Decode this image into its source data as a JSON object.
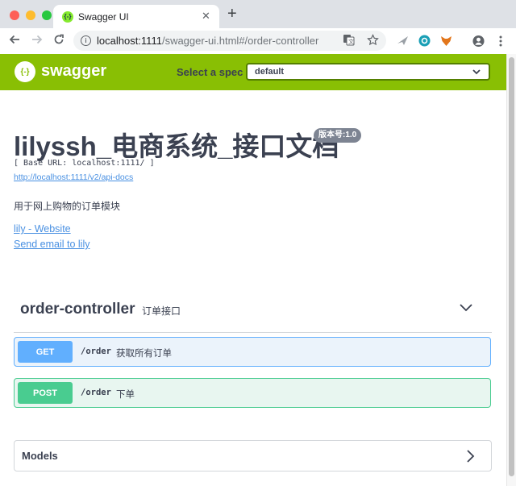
{
  "browser": {
    "tab_title": "Swagger UI",
    "tab_favicon": "{-}",
    "close_glyph": "✕",
    "new_tab_glyph": "+",
    "url_host": "localhost:1111",
    "url_path": "/swagger-ui.html#/order-controller",
    "icons": [
      "back-icon",
      "forward-icon",
      "reload-icon",
      "info-icon",
      "translate-icon",
      "star-icon",
      "extension-bird-icon",
      "extension-sync-icon",
      "extension-fox-icon",
      "profile-icon",
      "menu-icon"
    ]
  },
  "topbar": {
    "logo_glyph": "{-}",
    "logo_text": "swagger",
    "spec_label": "Select a spec",
    "spec_value": "default",
    "spec_chevron": "⌄",
    "bg_color": "#89bf04"
  },
  "info": {
    "title": "lilyssh_电商系统_接口文档",
    "version": "版本号:1.0",
    "base_url": "[ Base URL: localhost:1111/ ]",
    "api_docs_link": "http://localhost:1111/v2/api-docs",
    "description": "用于网上购物的订单模块",
    "website_link": "lily - Website",
    "email_link": "Send email to lily"
  },
  "tag": {
    "name": "order-controller",
    "description": "订单接口"
  },
  "operations": [
    {
      "method": "GET",
      "path": "/order",
      "summary": "获取所有订单",
      "color": "#61affe"
    },
    {
      "method": "POST",
      "path": "/order",
      "summary": "下单",
      "color": "#49cc90"
    }
  ],
  "models": {
    "title": "Models"
  }
}
